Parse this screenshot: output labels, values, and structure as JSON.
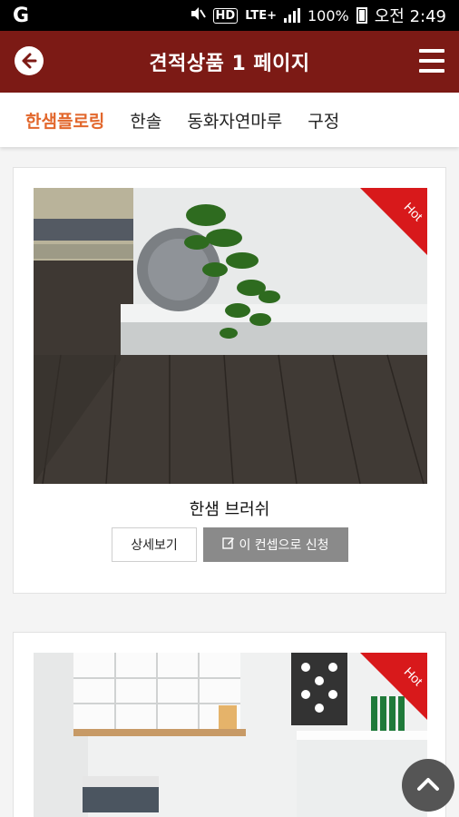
{
  "status_bar": {
    "carrier_icon": "G",
    "network": "LTE+",
    "battery": "100%",
    "time": "오전 2:49",
    "hd_label": "HD"
  },
  "app_bar": {
    "title": "견적상품 1 페이지",
    "back_icon": "back-arrow-icon",
    "menu_icon": "hamburger-menu-icon"
  },
  "tabs": [
    {
      "label": "한샘플로링",
      "active": true
    },
    {
      "label": "한솔",
      "active": false
    },
    {
      "label": "동화자연마루",
      "active": false
    },
    {
      "label": "구정",
      "active": false
    }
  ],
  "products": [
    {
      "name": "한샘 브러쉬",
      "badge": "Hot",
      "detail_label": "상세보기",
      "apply_label": "이 컨셉으로 신청"
    },
    {
      "name": "",
      "badge": "Hot"
    }
  ],
  "colors": {
    "brand": "#7c1a15",
    "tab_active": "#e2672c",
    "hot_badge": "#d8191b",
    "apply_button": "#8a8a8a"
  },
  "fab": {
    "icon": "chevron-up-icon"
  }
}
